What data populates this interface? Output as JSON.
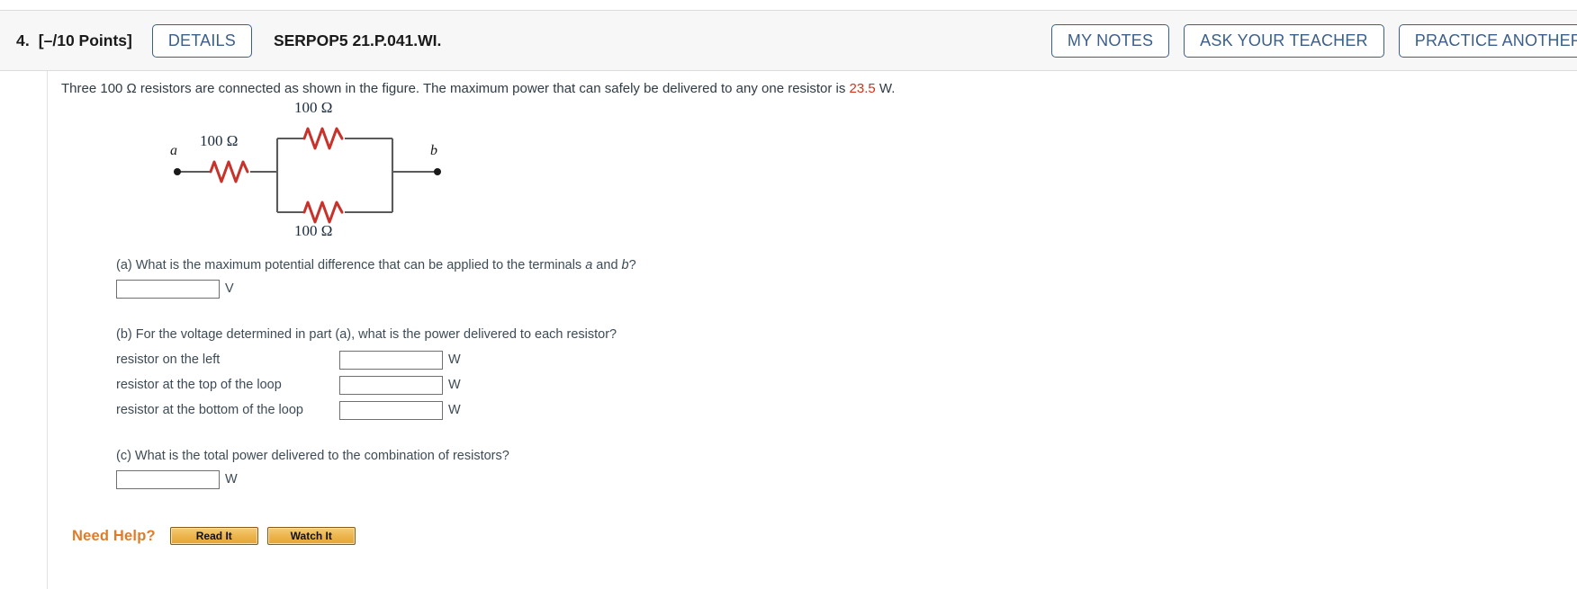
{
  "header": {
    "question_number": "4.",
    "points": "[–/10 Points]",
    "details_label": "DETAILS",
    "question_code": "SERPOP5 21.P.041.WI.",
    "my_notes_label": "MY NOTES",
    "ask_teacher_label": "ASK YOUR TEACHER",
    "practice_another_label": "PRACTICE ANOTHER",
    "accent_color": "#3a5f8a"
  },
  "stem": {
    "text_before": "Three 100 Ω resistors are connected as shown in the figure. The maximum power that can safely be delivered to any one resistor is ",
    "value": "23.5",
    "text_after": " W.",
    "value_color": "#d0321e"
  },
  "figure": {
    "terminal_a": "a",
    "terminal_b": "b",
    "label_left": "100 Ω",
    "label_top": "100 Ω",
    "label_bottom": "100 Ω",
    "resistor_color": "#c8322a",
    "wire_color": "#5a5a5a"
  },
  "parts": {
    "a": {
      "prompt_before": "(a) What is the maximum potential difference that can be applied to the terminals ",
      "term_a": "a",
      "prompt_middle": " and ",
      "term_b": "b",
      "prompt_after": "?",
      "answer_value": "",
      "unit": "V"
    },
    "b": {
      "prompt": "(b) For the voltage determined in part (a), what is the power delivered to each resistor?",
      "rows": [
        {
          "label": "resistor on the left",
          "answer_value": "",
          "unit": "W"
        },
        {
          "label": "resistor at the top of the loop",
          "answer_value": "",
          "unit": "W"
        },
        {
          "label": "resistor at the bottom of the loop",
          "answer_value": "",
          "unit": "W"
        }
      ]
    },
    "c": {
      "prompt": "(c) What is the total power delivered to the combination of resistors?",
      "answer_value": "",
      "unit": "W"
    }
  },
  "need_help": {
    "label": "Need Help?",
    "read_it_label": "Read It",
    "watch_it_label": "Watch It",
    "label_color": "#e07b29"
  }
}
